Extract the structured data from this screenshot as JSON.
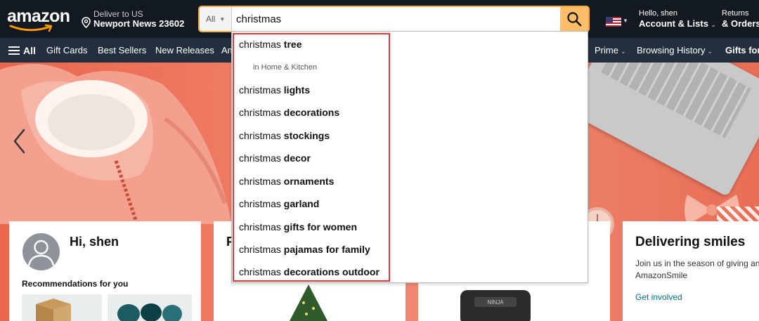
{
  "header": {
    "logo_text": "amazon",
    "deliver_line1": "Deliver to US",
    "deliver_line2": "Newport News 23602",
    "account_line1": "Hello, shen",
    "account_line2": "Account & Lists",
    "returns_line1": "Returns",
    "returns_line2": "& Orders"
  },
  "search": {
    "category": "All",
    "query": "christmas",
    "icon": "search-icon"
  },
  "nav": {
    "all_label": "All",
    "items": [
      "Gift Cards",
      "Best Sellers",
      "New Releases",
      "Am",
      "Prime",
      "Browsing History",
      "Gifts for"
    ]
  },
  "suggestions": {
    "items": [
      {
        "prefix": "christmas",
        "suffix": "tree"
      },
      {
        "prefix": "christmas",
        "suffix": "lights"
      },
      {
        "prefix": "christmas",
        "suffix": "decorations"
      },
      {
        "prefix": "christmas",
        "suffix": "stockings"
      },
      {
        "prefix": "christmas",
        "suffix": "decor"
      },
      {
        "prefix": "christmas",
        "suffix": "ornaments"
      },
      {
        "prefix": "christmas",
        "suffix": "garland"
      },
      {
        "prefix": "christmas",
        "suffix": "gifts for women"
      },
      {
        "prefix": "christmas",
        "suffix": "pajamas for family"
      },
      {
        "prefix": "christmas",
        "suffix": "decorations outdoor"
      }
    ],
    "department_in": "in",
    "department": "Home & Kitchen"
  },
  "cards": {
    "greeting": "Hi, shen",
    "recommendations": "Recommendations for you",
    "card2_title_fragment": "F",
    "smiles_title": "Delivering smiles",
    "smiles_text": "Join us in the season of giving and AmazonSmile",
    "smiles_link": "Get involved"
  },
  "colors": {
    "header_bg": "#131921",
    "nav_bg": "#232f3e",
    "search_button": "#febd69",
    "search_border": "#f3a847",
    "highlight_box": "#e0373d",
    "hero_bg": "#ef7a62",
    "link": "#007185"
  }
}
